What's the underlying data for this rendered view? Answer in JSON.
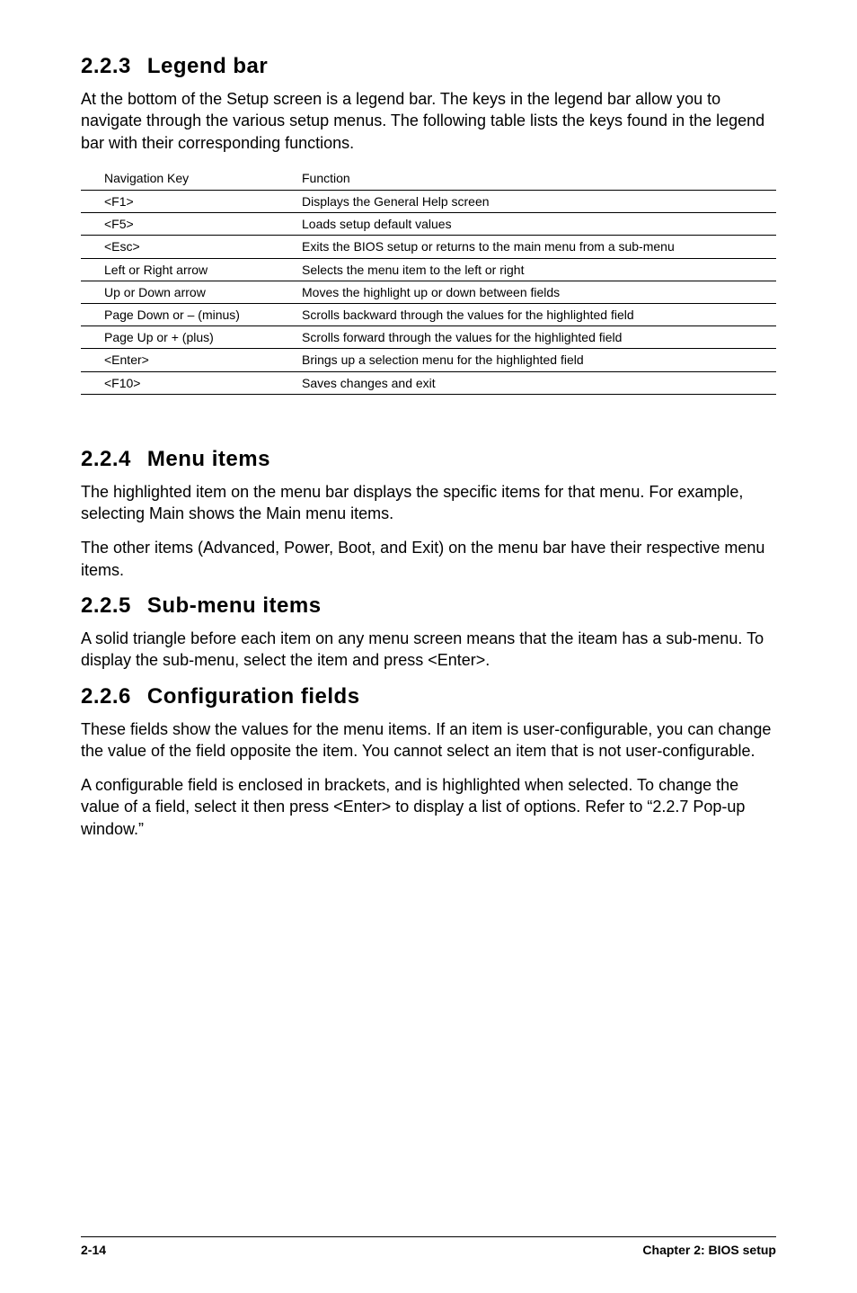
{
  "sections": {
    "legend_bar": {
      "number": "2.2.3",
      "title": "Legend bar",
      "intro": "At the bottom of the Setup screen is a legend bar. The keys in the legend bar allow you to navigate through the various setup menus. The following table lists the keys found in the legend bar with their corresponding functions.",
      "table": {
        "header_key": "Navigation Key",
        "header_func": "Function",
        "rows": [
          {
            "key": "<F1>",
            "func": "Displays the General Help screen"
          },
          {
            "key": "<F5>",
            "func": "Loads setup default values"
          },
          {
            "key": "<Esc>",
            "func": "Exits the BIOS setup or returns to the main menu from a sub-menu"
          },
          {
            "key": "Left or Right arrow",
            "func": "Selects the menu item to the left or right"
          },
          {
            "key": "Up or Down arrow",
            "func": "Moves the highlight up or down between fields"
          },
          {
            "key": "Page Down or – (minus)",
            "func": "Scrolls backward through the values for the highlighted field"
          },
          {
            "key": "Page Up or + (plus)",
            "func": "Scrolls forward through the values for the highlighted field"
          },
          {
            "key": "<Enter>",
            "func": "Brings up a selection menu for the highlighted field"
          },
          {
            "key": "<F10>",
            "func": "Saves changes and exit"
          }
        ]
      }
    },
    "menu_items": {
      "number": "2.2.4",
      "title": "Menu items",
      "p1": "The highlighted item on the menu bar  displays the specific items for that menu. For example, selecting Main shows the Main menu items.",
      "p2": "The other items (Advanced, Power, Boot, and Exit) on the menu bar have their respective menu items."
    },
    "sub_menu": {
      "number": "2.2.5",
      "title": "Sub-menu items",
      "p1": "A solid triangle before each item on any menu screen means that the iteam has a sub-menu. To display the sub-menu, select the item and press <Enter>."
    },
    "config_fields": {
      "number": "2.2.6",
      "title": "Configuration fields",
      "p1": "These fields show the values for the menu items. If an item is user-configurable, you can change the value of the field opposite the item. You cannot select an item that is not user-configurable.",
      "p2": "A configurable field is enclosed in brackets, and is highlighted when selected. To change the value of a field, select it then press <Enter> to display a list of options. Refer to “2.2.7 Pop-up window.”"
    }
  },
  "footer": {
    "left": "2-14",
    "right": "Chapter 2: BIOS setup"
  }
}
